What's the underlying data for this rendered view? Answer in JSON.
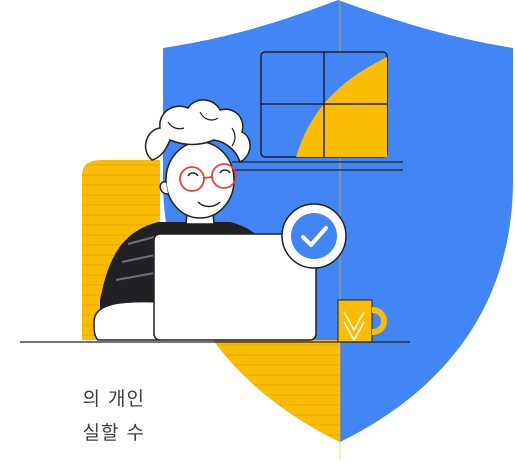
{
  "illustration": {
    "description_icon": "shield-icon",
    "check_icon": "check-icon",
    "colors": {
      "shield_blue": "#4285f4",
      "yellow": "#fbbc04",
      "outline": "#202124",
      "white": "#ffffff",
      "glasses_red": "#ea4335"
    }
  },
  "caption": {
    "line1": "의 개인",
    "line2": "실할 수"
  }
}
